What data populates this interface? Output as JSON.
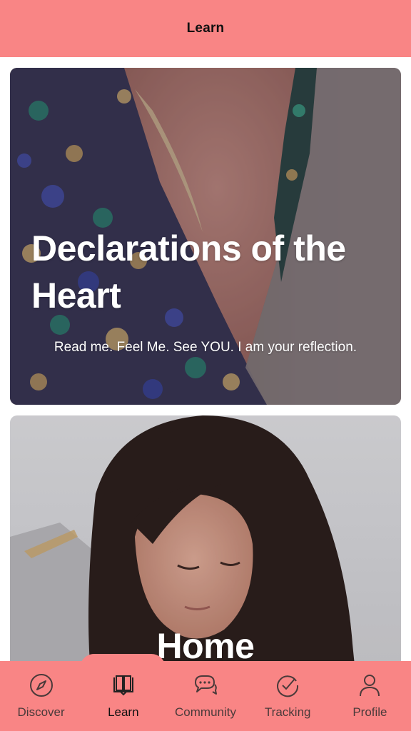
{
  "header": {
    "title": "Learn"
  },
  "cards": [
    {
      "title": "Declarations of the Heart",
      "subtitle": "Read me. Feel Me. See YOU. I am your reflection."
    },
    {
      "title": "Home",
      "subtitle": ""
    }
  ],
  "tabbar": {
    "items": [
      {
        "label": "Discover",
        "icon": "compass-icon"
      },
      {
        "label": "Learn",
        "icon": "book-icon",
        "active": true
      },
      {
        "label": "Community",
        "icon": "chat-bubbles-icon"
      },
      {
        "label": "Tracking",
        "icon": "check-circle-icon"
      },
      {
        "label": "Profile",
        "icon": "person-icon"
      }
    ]
  },
  "colors": {
    "brand": "#f98585",
    "header_text": "#111111",
    "tab_label": "#4a3a3a"
  }
}
